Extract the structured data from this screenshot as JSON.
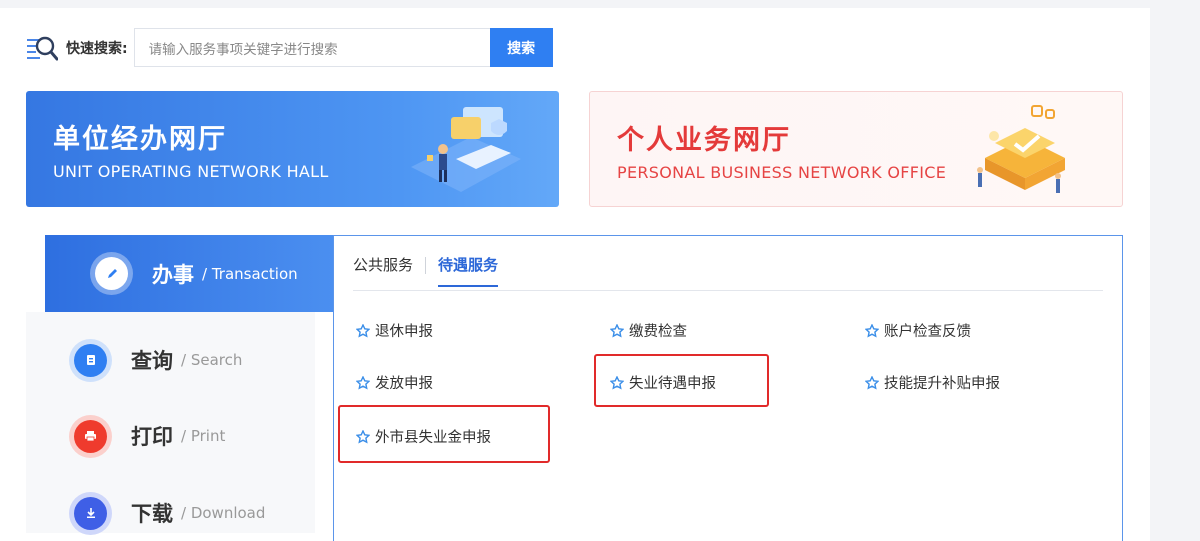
{
  "search": {
    "label": "快速搜索:",
    "placeholder": "请输入服务事项关键字进行搜索",
    "button_label": "搜索"
  },
  "halls": {
    "unit": {
      "title": "单位经办网厅",
      "subtitle": "UNIT OPERATING NETWORK HALL"
    },
    "personal": {
      "title": "个人业务网厅",
      "subtitle": "PERSONAL BUSINESS NETWORK OFFICE"
    }
  },
  "nav": {
    "items": [
      {
        "name": "办事",
        "en": "/ Transaction",
        "icon": "pen-icon",
        "color": "#ffffff"
      },
      {
        "name": "查询",
        "en": "/ Search",
        "icon": "document-icon",
        "color": "#2f7ff2"
      },
      {
        "name": "打印",
        "en": "/ Print",
        "icon": "printer-icon",
        "color": "#ef3b2d"
      },
      {
        "name": "下载",
        "en": "/ Download",
        "icon": "download-icon",
        "color": "#3f5fe6"
      }
    ]
  },
  "tabs": [
    {
      "label": "公共服务"
    },
    {
      "label": "待遇服务"
    }
  ],
  "services": [
    {
      "label": "退休申报"
    },
    {
      "label": "缴费检查"
    },
    {
      "label": "账户检查反馈"
    },
    {
      "label": "发放申报"
    },
    {
      "label": "失业待遇申报"
    },
    {
      "label": "技能提升补贴申报"
    },
    {
      "label": "外市县失业金申报"
    }
  ],
  "colors": {
    "accent": "#2f7ff2",
    "highlight_box": "#e12a2a",
    "personal_red": "#e43a3a"
  }
}
